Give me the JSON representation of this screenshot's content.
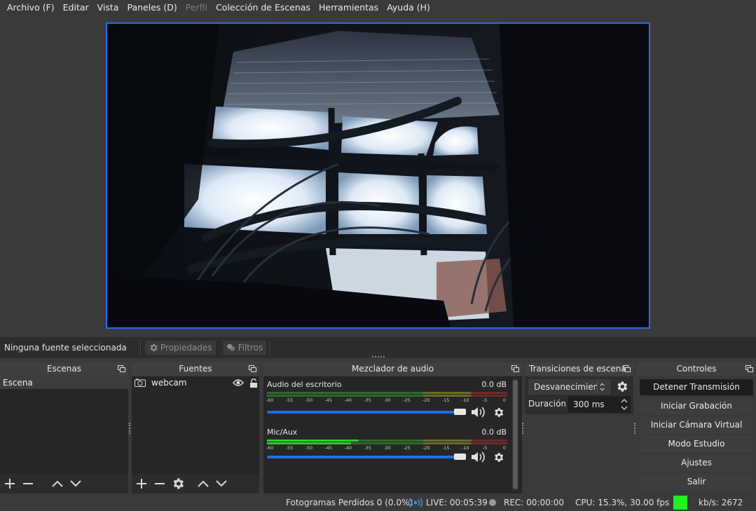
{
  "menu": [
    "Archivo (F)",
    "Editar",
    "Vista",
    "Paneles (D)",
    "Perfil",
    "Colección de Escenas",
    "Herramientas",
    "Ayuda (H)"
  ],
  "source_toolbar": {
    "no_source": "Ninguna fuente seleccionada",
    "properties": "Propiedades",
    "filters": "Filtros"
  },
  "scenes": {
    "title": "Escenas",
    "items": [
      "Escena"
    ]
  },
  "sources": {
    "title": "Fuentes",
    "items": [
      {
        "name": "webcam",
        "icon": "camera-icon"
      }
    ]
  },
  "mixer": {
    "title": "Mezclador de audio",
    "scale": [
      "-60",
      "-55",
      "-50",
      "-45",
      "-40",
      "-35",
      "-30",
      "-25",
      "-20",
      "-15",
      "-10",
      "-5",
      "0"
    ],
    "channels": [
      {
        "name": "Audio del escritorio",
        "db": "0.0 dB",
        "volume_fraction": 1.0
      },
      {
        "name": "Mic/Aux",
        "db": "0.0 dB",
        "volume_fraction": 1.0
      }
    ]
  },
  "transitions": {
    "title": "Transiciones de escena",
    "selected": "Desvanecimiento",
    "duration_label": "Duración",
    "duration_value": "300 ms"
  },
  "controls": {
    "title": "Controles",
    "buttons": [
      "Detener Transmisión",
      "Iniciar Grabación",
      "Iniciar Cámara Virtual",
      "Modo Estudio",
      "Ajustes",
      "Salir"
    ]
  },
  "status": {
    "dropped": "Fotogramas Perdidos 0 (0.0%)",
    "live": "LIVE: 00:05:39",
    "rec": "REC: 00:00:00",
    "cpu": "CPU: 15.3%, 30.00 fps",
    "kbs": "kb/s: 2672",
    "health_color": "#22ee22"
  },
  "colors": {
    "accent": "#1f6ff5",
    "slider": "#1d6fe0"
  }
}
